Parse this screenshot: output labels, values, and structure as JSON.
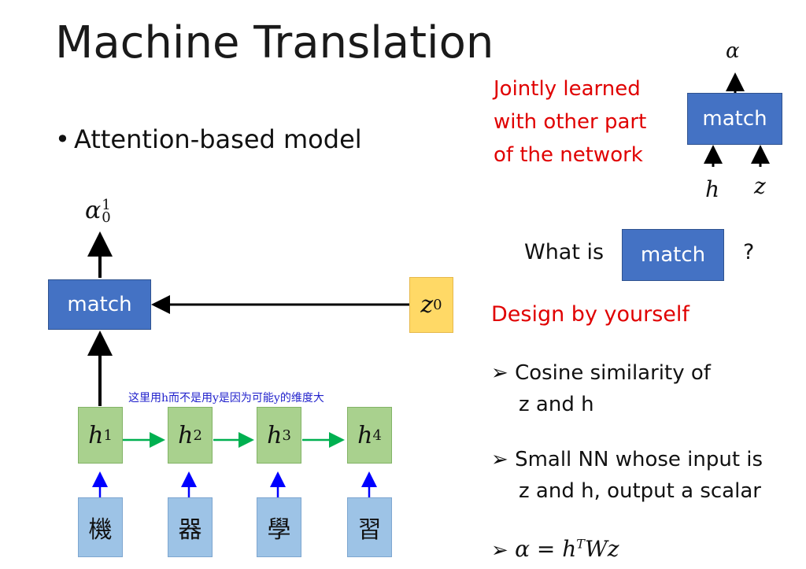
{
  "slide": {
    "title": "Machine Translation",
    "bullet": "Attention-based model"
  },
  "diagram": {
    "alpha_base": "α",
    "alpha_sub": "0",
    "alpha_sup": "1",
    "match_label": "match",
    "z_base": "z",
    "z_sup": "0",
    "note": "这里用h而不是用y是因为可能y的维度大",
    "hidden": [
      {
        "base": "h",
        "sup": "1"
      },
      {
        "base": "h",
        "sup": "2"
      },
      {
        "base": "h",
        "sup": "3"
      },
      {
        "base": "h",
        "sup": "4"
      }
    ],
    "inputs": [
      "機",
      "器",
      "學",
      "習"
    ]
  },
  "side": {
    "red_note": [
      "Jointly learned",
      "with other part",
      "of the network"
    ],
    "mini_alpha": "α",
    "mini_match": "match",
    "mini_h": "h",
    "mini_z": "z",
    "question_prefix": "What is",
    "question_match": "match",
    "question_mark": "?",
    "design": "Design by yourself",
    "options": [
      [
        "Cosine similarity of",
        "z and h"
      ],
      [
        "Small NN whose input is",
        "z and h, output a scalar"
      ]
    ],
    "formula_lhs": "α = h",
    "formula_sup": "T",
    "formula_rhs": "Wz"
  },
  "colors": {
    "match_blue": "#4472c4",
    "hidden_green": "#a9d18e",
    "input_blue": "#9dc3e6",
    "z_orange": "#ffd966",
    "red_text": "#e00000",
    "arrow_green": "#00b050",
    "arrow_blue": "#0000ff"
  }
}
